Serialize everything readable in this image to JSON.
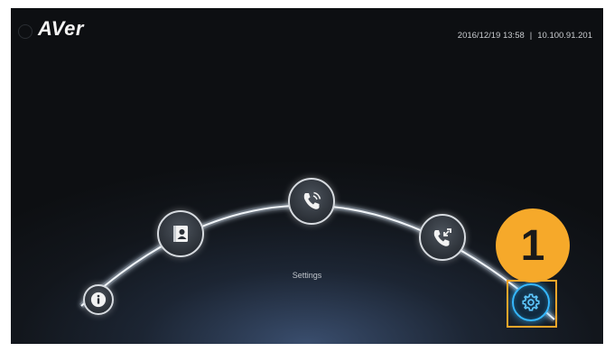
{
  "header": {
    "logo_text": "AVer",
    "datetime": "2016/12/19 13:58",
    "separator": "|",
    "ip_address": "10.100.91.201"
  },
  "menu": {
    "selected_label": "Settings",
    "items": [
      {
        "id": "info",
        "icon": "info-icon"
      },
      {
        "id": "contacts",
        "icon": "contacts-book-icon"
      },
      {
        "id": "call",
        "icon": "phone-call-icon"
      },
      {
        "id": "call-history",
        "icon": "phone-in-out-icon"
      },
      {
        "id": "settings",
        "icon": "gear-icon",
        "selected": true
      }
    ]
  },
  "annotation": {
    "step_number": "1",
    "highlight_color": "#f4a62a",
    "badge_color": "#f6a92a"
  },
  "colors": {
    "selected_glow": "#35b8ff",
    "arc": "#f0f4f8"
  }
}
